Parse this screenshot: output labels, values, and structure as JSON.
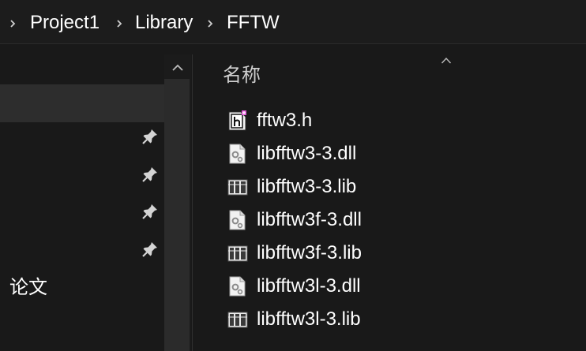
{
  "breadcrumb": {
    "items": [
      {
        "label": "Project1"
      },
      {
        "label": "Library"
      },
      {
        "label": "FFTW"
      }
    ]
  },
  "nav": {
    "pinned_count": 4,
    "partial_label": "论文"
  },
  "list": {
    "column_header": "名称",
    "files": [
      {
        "name": "fftw3.h",
        "icon": "header-file-icon"
      },
      {
        "name": "libfftw3-3.dll",
        "icon": "dll-file-icon"
      },
      {
        "name": "libfftw3-3.lib",
        "icon": "lib-file-icon"
      },
      {
        "name": "libfftw3f-3.dll",
        "icon": "dll-file-icon"
      },
      {
        "name": "libfftw3f-3.lib",
        "icon": "lib-file-icon"
      },
      {
        "name": "libfftw3l-3.dll",
        "icon": "dll-file-icon"
      },
      {
        "name": "libfftw3l-3.lib",
        "icon": "lib-file-icon"
      }
    ]
  },
  "colors": {
    "background": "#191919",
    "selected": "#2d2d2d",
    "text": "#ffffff"
  }
}
